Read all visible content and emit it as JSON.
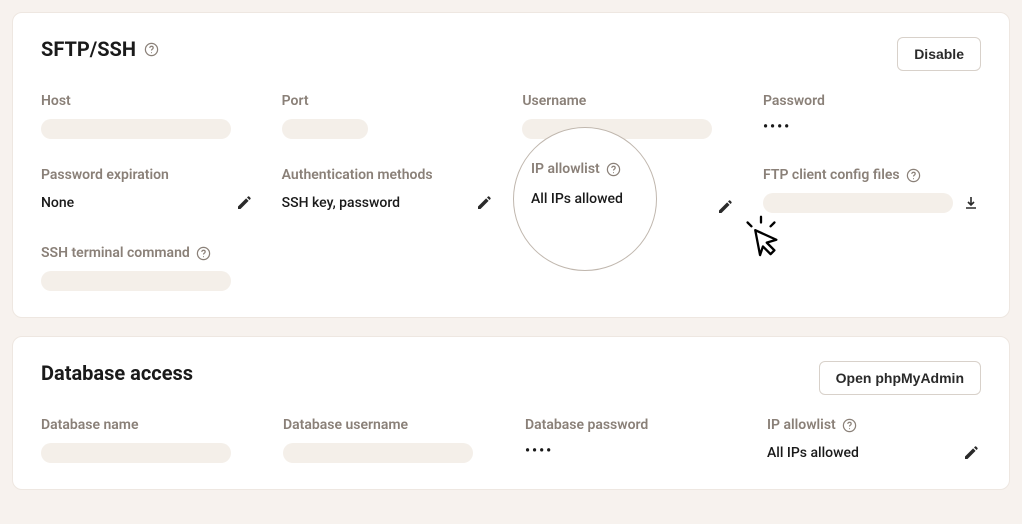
{
  "sftp": {
    "title": "SFTP/SSH",
    "disable_button": "Disable",
    "host_label": "Host",
    "port_label": "Port",
    "username_label": "Username",
    "password_label": "Password",
    "password_value": "••••",
    "password_expiration_label": "Password expiration",
    "password_expiration_value": "None",
    "auth_methods_label": "Authentication methods",
    "auth_methods_value": "SSH key, password",
    "ip_allowlist_label": "IP allowlist",
    "ip_allowlist_value": "All IPs allowed",
    "ftp_config_label": "FTP client config files",
    "ssh_terminal_label": "SSH terminal command"
  },
  "db": {
    "title": "Database access",
    "open_button": "Open phpMyAdmin",
    "name_label": "Database name",
    "username_label": "Database username",
    "password_label": "Database password",
    "password_value": "••••",
    "ip_allowlist_label": "IP allowlist",
    "ip_allowlist_value": "All IPs allowed"
  }
}
